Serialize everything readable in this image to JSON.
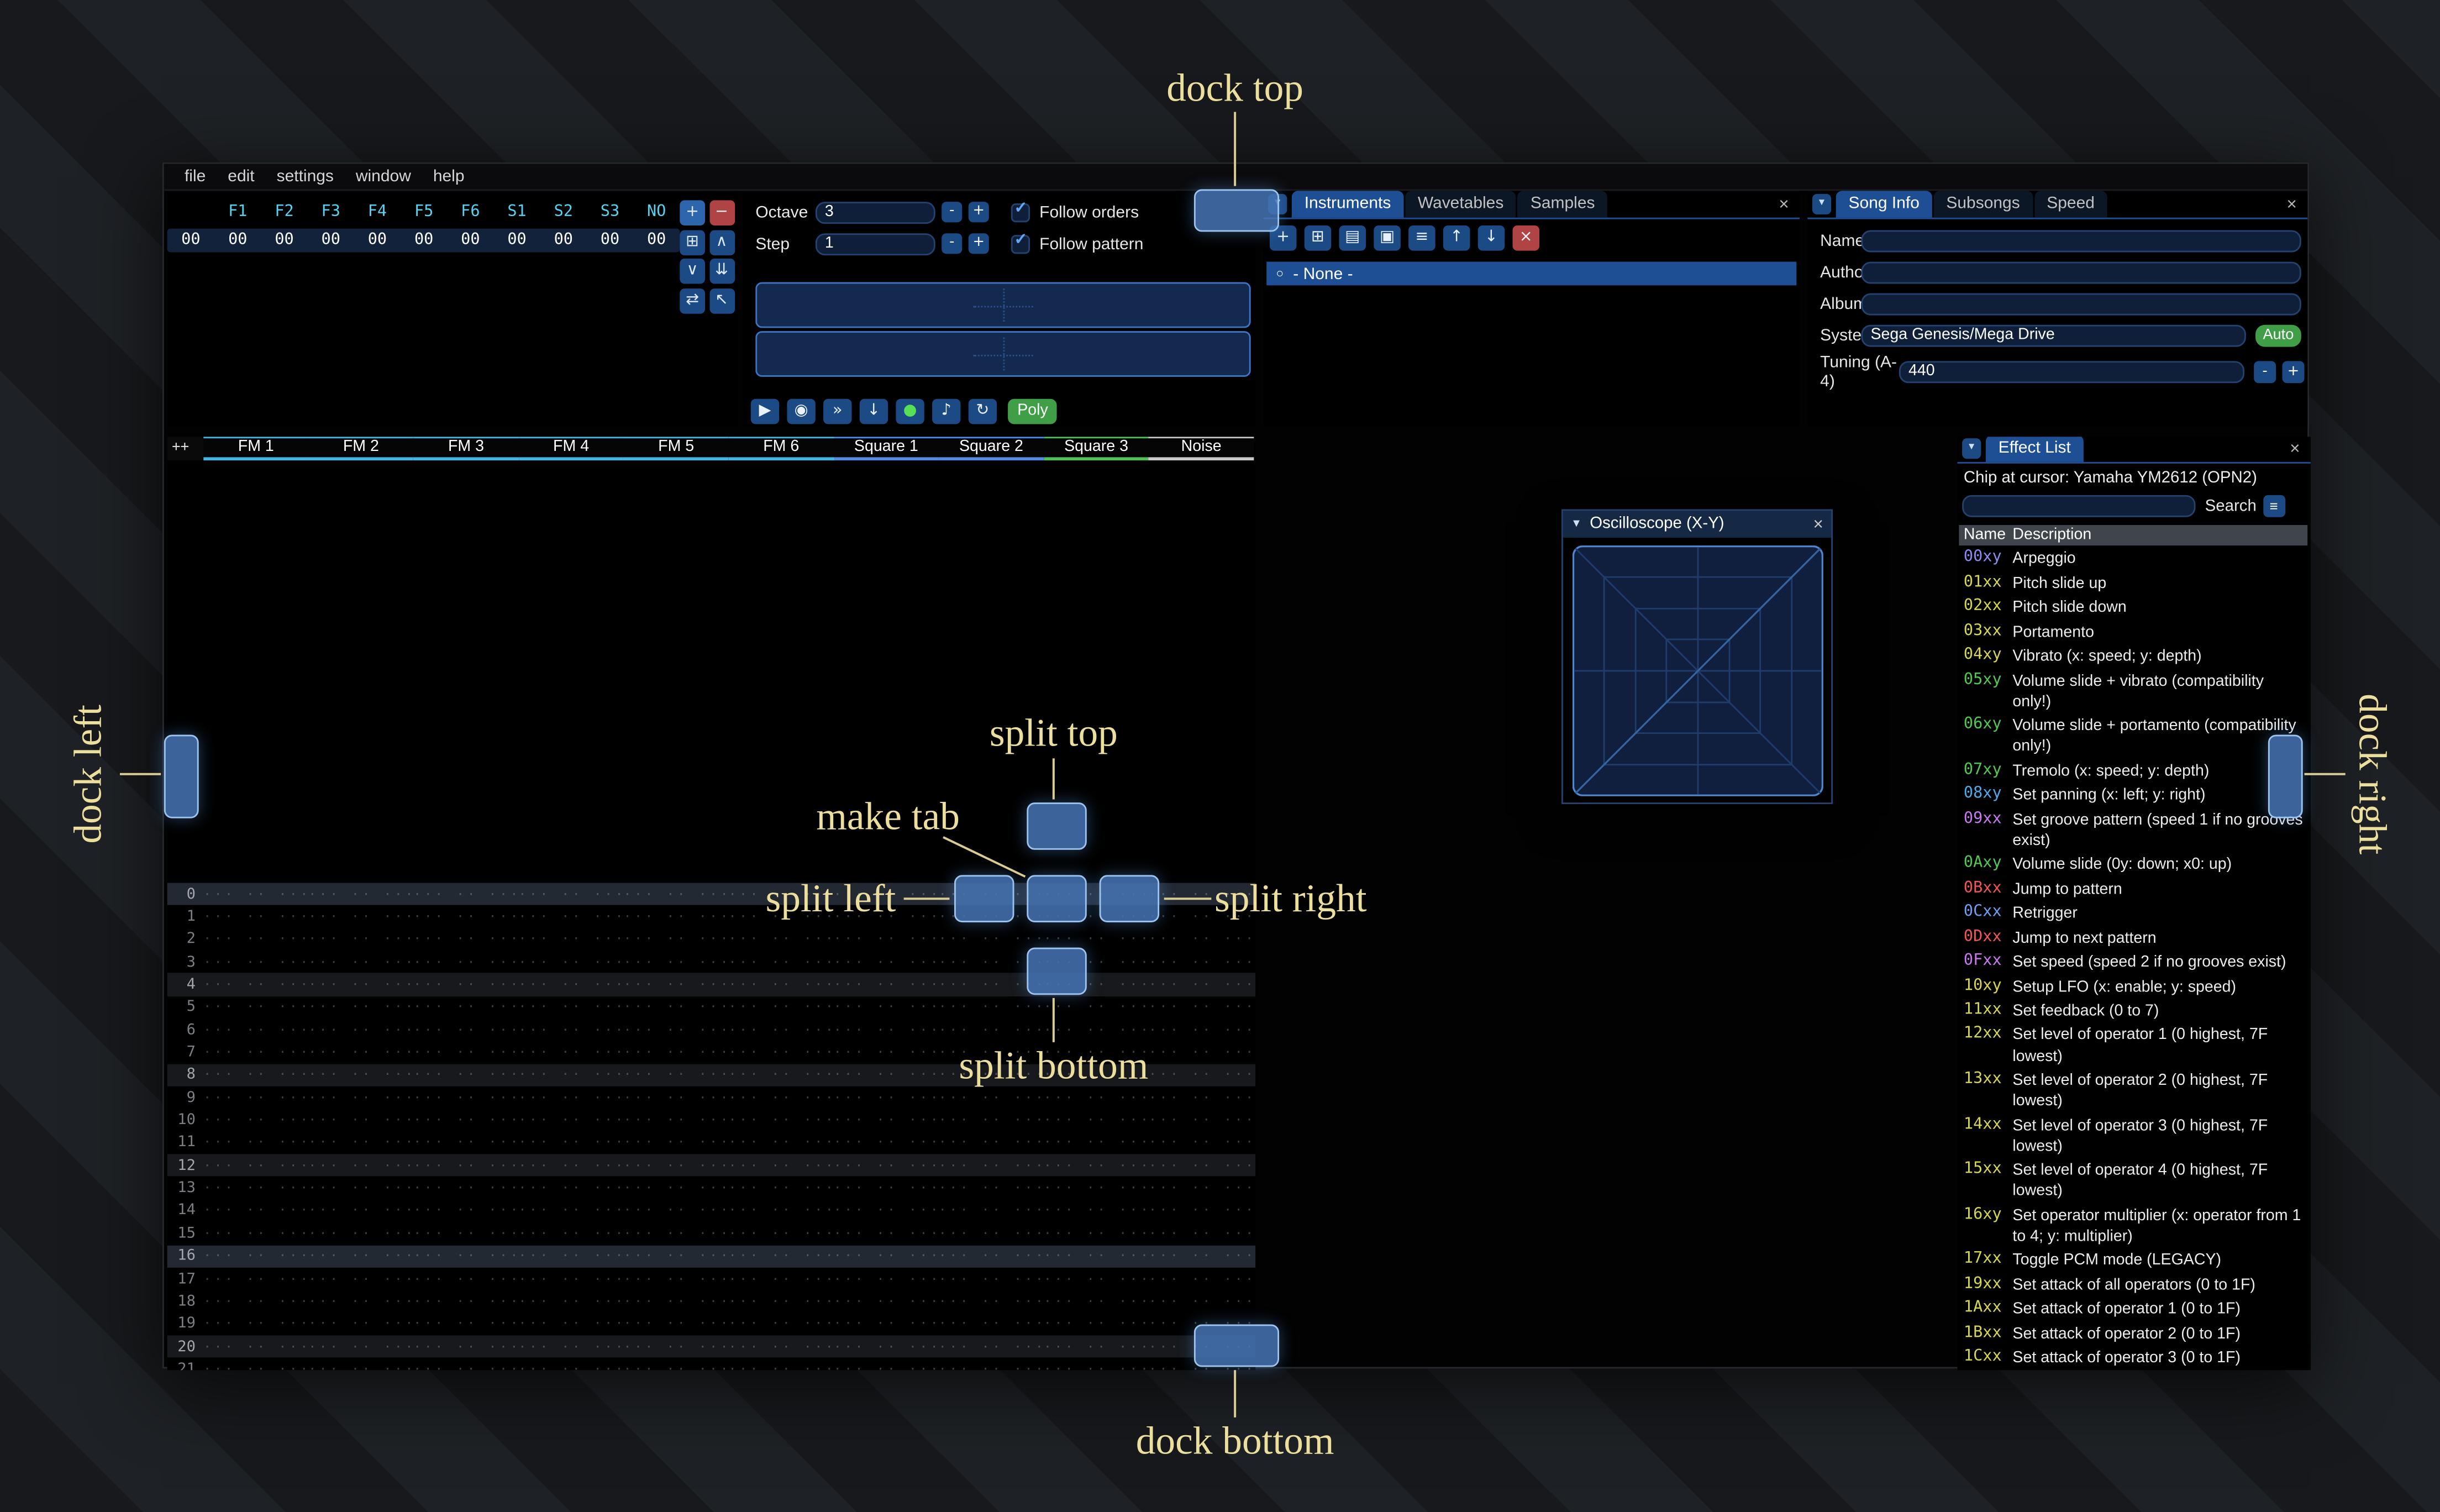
{
  "icons": {
    "close": "×",
    "collapse": "▼",
    "menu": "≡",
    "radio": "○",
    "check": "✓"
  },
  "window": {
    "menu": [
      "file",
      "edit",
      "settings",
      "window",
      "help"
    ]
  },
  "orders": {
    "row_index": "00",
    "channels": [
      "F1",
      "F2",
      "F3",
      "F4",
      "F5",
      "F6",
      "S1",
      "S2",
      "S3",
      "NO"
    ],
    "values": [
      "00",
      "00",
      "00",
      "00",
      "00",
      "00",
      "00",
      "00",
      "00",
      "00"
    ],
    "buttons": [
      {
        "name": "order-add",
        "glyph": "+",
        "style": "bright"
      },
      {
        "name": "order-remove",
        "glyph": "−",
        "style": "red"
      },
      {
        "name": "order-duplicate",
        "glyph": "⊞",
        "style": ""
      },
      {
        "name": "order-move-up",
        "glyph": "∧",
        "style": ""
      },
      {
        "name": "order-move-down",
        "glyph": "∨",
        "style": ""
      },
      {
        "name": "order-duplicate-end",
        "glyph": "⇊",
        "style": ""
      },
      {
        "name": "order-change-mode",
        "glyph": "⇄",
        "style": ""
      },
      {
        "name": "order-edit-mode",
        "glyph": "↖",
        "style": ""
      }
    ]
  },
  "transport": {
    "octave_label": "Octave",
    "octave_value": "3",
    "step_label": "Step",
    "step_value": "1",
    "minus": "-",
    "plus": "+",
    "follow_orders": "Follow orders",
    "follow_pattern": "Follow pattern",
    "buttons": [
      {
        "name": "play",
        "glyph": "▶",
        "style": ""
      },
      {
        "name": "stop",
        "glyph": "◉",
        "style": ""
      },
      {
        "name": "play-pattern",
        "glyph": "»",
        "style": ""
      },
      {
        "name": "step-row",
        "glyph": "↓",
        "style": ""
      },
      {
        "name": "record",
        "glyph": "●",
        "style": "green"
      },
      {
        "name": "metronome",
        "glyph": "♪",
        "style": ""
      },
      {
        "name": "repeat-pattern",
        "glyph": "↻",
        "style": ""
      }
    ],
    "poly_label": "Poly"
  },
  "instruments": {
    "tabs": [
      "Instruments",
      "Wavetables",
      "Samples"
    ],
    "active_tab": "Instruments",
    "toolbar": [
      {
        "name": "instrument-add",
        "glyph": "+",
        "style": ""
      },
      {
        "name": "instrument-duplicate",
        "glyph": "⊞",
        "style": ""
      },
      {
        "name": "instrument-open",
        "glyph": "▤",
        "style": ""
      },
      {
        "name": "instrument-save",
        "glyph": "▣",
        "style": ""
      },
      {
        "name": "instrument-folders",
        "glyph": "≡",
        "style": ""
      },
      {
        "name": "instrument-move-up",
        "glyph": "↑",
        "style": ""
      },
      {
        "name": "instrument-move-down",
        "glyph": "↓",
        "style": ""
      },
      {
        "name": "instrument-delete",
        "glyph": "×",
        "style": "red"
      }
    ],
    "list": [
      {
        "label": "- None -",
        "selected": true
      }
    ]
  },
  "song_info": {
    "tabs": [
      "Song Info",
      "Subsongs",
      "Speed"
    ],
    "active_tab": "Song Info",
    "fields": [
      {
        "label": "Name",
        "value": ""
      },
      {
        "label": "Author",
        "value": ""
      },
      {
        "label": "Album",
        "value": ""
      }
    ],
    "system_label": "System",
    "system_value": "Sega Genesis/Mega Drive",
    "auto_label": "Auto",
    "tuning_label": "Tuning (A-4)",
    "tuning_value": "440"
  },
  "pattern": {
    "corner_button": "++",
    "channels": [
      {
        "name": "FM 1",
        "color": "#3fb6ea"
      },
      {
        "name": "FM 2",
        "color": "#3fb6ea"
      },
      {
        "name": "FM 3",
        "color": "#3fb6ea"
      },
      {
        "name": "FM 4",
        "color": "#3fb6ea"
      },
      {
        "name": "FM 5",
        "color": "#3fb6ea"
      },
      {
        "name": "FM 6",
        "color": "#3fb6ea"
      },
      {
        "name": "Square 1",
        "color": "#4f8bea"
      },
      {
        "name": "Square 2",
        "color": "#4f8bea"
      },
      {
        "name": "Square 3",
        "color": "#49c455"
      },
      {
        "name": "Noise",
        "color": "#c8c8c8"
      }
    ],
    "visible_rows": 22,
    "highlight_minor": 4,
    "highlight_major": 16,
    "empty_cell": "··· ·· ···"
  },
  "oscilloscope": {
    "title": "Oscilloscope (X-Y)"
  },
  "effect_list": {
    "title": "Effect List",
    "chip_line": "Chip at cursor: Yamaha YM2612 (OPN2)",
    "search_label": "Search",
    "search_value": "",
    "columns": [
      "Name",
      "Description"
    ],
    "rows": [
      {
        "code": "00xy",
        "color": "#8b8bf0",
        "desc": "Arpeggio"
      },
      {
        "code": "01xx",
        "color": "#d6d64f",
        "desc": "Pitch slide up"
      },
      {
        "code": "02xx",
        "color": "#d6d64f",
        "desc": "Pitch slide down"
      },
      {
        "code": "03xx",
        "color": "#d6d64f",
        "desc": "Portamento"
      },
      {
        "code": "04xy",
        "color": "#d6d64f",
        "desc": "Vibrato (x: speed; y: depth)"
      },
      {
        "code": "05xy",
        "color": "#4fc94f",
        "desc": "Volume slide + vibrato (compatibility only!)"
      },
      {
        "code": "06xy",
        "color": "#4fc94f",
        "desc": "Volume slide + portamento (compatibility only!)"
      },
      {
        "code": "07xy",
        "color": "#4fc94f",
        "desc": "Tremolo (x: speed; y: depth)"
      },
      {
        "code": "08xy",
        "color": "#4fa8e8",
        "desc": "Set panning (x: left; y: right)"
      },
      {
        "code": "09xx",
        "color": "#c879f2",
        "desc": "Set groove pattern (speed 1 if no grooves exist)"
      },
      {
        "code": "0Axy",
        "color": "#4fc94f",
        "desc": "Volume slide (0y: down; x0: up)"
      },
      {
        "code": "0Bxx",
        "color": "#f25555",
        "desc": "Jump to pattern"
      },
      {
        "code": "0Cxx",
        "color": "#6f9ff2",
        "desc": "Retrigger"
      },
      {
        "code": "0Dxx",
        "color": "#f25555",
        "desc": "Jump to next pattern"
      },
      {
        "code": "0Fxx",
        "color": "#c879f2",
        "desc": "Set speed (speed 2 if no grooves exist)"
      },
      {
        "code": "10xy",
        "color": "#d6d64f",
        "desc": "Setup LFO (x: enable; y: speed)"
      },
      {
        "code": "11xx",
        "color": "#d6d64f",
        "desc": "Set feedback (0 to 7)"
      },
      {
        "code": "12xx",
        "color": "#d6d64f",
        "desc": "Set level of operator 1 (0 highest, 7F lowest)"
      },
      {
        "code": "13xx",
        "color": "#d6d64f",
        "desc": "Set level of operator 2 (0 highest, 7F lowest)"
      },
      {
        "code": "14xx",
        "color": "#d6d64f",
        "desc": "Set level of operator 3 (0 highest, 7F lowest)"
      },
      {
        "code": "15xx",
        "color": "#d6d64f",
        "desc": "Set level of operator 4 (0 highest, 7F lowest)"
      },
      {
        "code": "16xy",
        "color": "#d6d64f",
        "desc": "Set operator multiplier (x: operator from 1 to 4; y: multiplier)"
      },
      {
        "code": "17xx",
        "color": "#d6d64f",
        "desc": "Toggle PCM mode (LEGACY)"
      },
      {
        "code": "19xx",
        "color": "#d6d64f",
        "desc": "Set attack of all operators (0 to 1F)"
      },
      {
        "code": "1Axx",
        "color": "#d6d64f",
        "desc": "Set attack of operator 1 (0 to 1F)"
      },
      {
        "code": "1Bxx",
        "color": "#d6d64f",
        "desc": "Set attack of operator 2 (0 to 1F)"
      },
      {
        "code": "1Cxx",
        "color": "#d6d64f",
        "desc": "Set attack of operator 3 (0 to 1F)"
      }
    ]
  },
  "dock_overlay": {
    "accent_color": "#4a7dbd",
    "labels": {
      "dock_top": "dock top",
      "dock_bottom": "dock bottom",
      "dock_left": "dock left",
      "dock_right": "dock right",
      "split_top": "split top",
      "split_bottom": "split bottom",
      "split_left": "split left",
      "split_right": "split right",
      "make_tab": "make tab"
    }
  }
}
